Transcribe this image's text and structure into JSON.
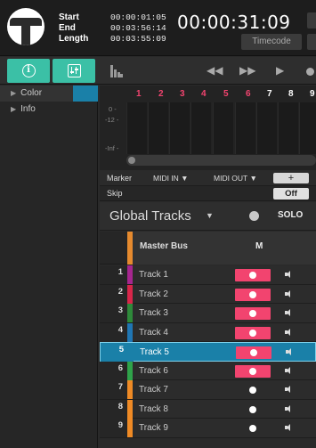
{
  "header": {
    "labels": [
      "Start",
      "End",
      "Length"
    ],
    "values": [
      "00:00:01:05",
      "00:03:56:14",
      "00:03:55:09"
    ],
    "current_time": "00:00:31:09",
    "time_mode": "Timecode"
  },
  "icons": {
    "logo": "t-logo",
    "info": "info-icon",
    "mixer": "mixer-icon",
    "meter": "meter-icon",
    "rewind": "rewind-icon",
    "fast_forward": "fast-forward-icon",
    "play": "play-icon",
    "record": "record-icon"
  },
  "inspector": {
    "items": [
      {
        "label": "Color"
      },
      {
        "label": "Info"
      }
    ],
    "color_value": "#1a80a8"
  },
  "meters": {
    "channels": [
      "1",
      "2",
      "3",
      "4",
      "5",
      "6",
      "7",
      "8",
      "9"
    ],
    "scale": [
      "0 -",
      "-12 -",
      "-Inf -"
    ]
  },
  "marker_row": {
    "label": "Marker",
    "midi_in": "MIDI IN ▼",
    "midi_out": "MIDI OUT ▼",
    "add": "+"
  },
  "skip_row": {
    "label": "Skip",
    "state": "Off"
  },
  "global_tracks": {
    "title": "Global Tracks",
    "caret": "▼",
    "solo_label": "SOLO"
  },
  "master_bus": {
    "name": "Master Bus",
    "mute_label": "M",
    "color": "#e68a2e"
  },
  "tracks": [
    {
      "num": "1",
      "name": "Track 1",
      "color": "#a6268f",
      "armed": true
    },
    {
      "num": "2",
      "name": "Track 2",
      "color": "#d8264a",
      "armed": true
    },
    {
      "num": "3",
      "name": "Track 3",
      "color": "#2e8a3a",
      "armed": true
    },
    {
      "num": "4",
      "name": "Track 4",
      "color": "#1f76b4",
      "armed": true
    },
    {
      "num": "5",
      "name": "Track 5",
      "color": "#1a80a8",
      "armed": true,
      "selected": true
    },
    {
      "num": "6",
      "name": "Track 6",
      "color": "#2fa34a",
      "armed": true
    },
    {
      "num": "7",
      "name": "Track 7",
      "color": "#ef8a25",
      "armed": false
    },
    {
      "num": "8",
      "name": "Track 8",
      "color": "#ef8a25",
      "armed": false
    },
    {
      "num": "9",
      "name": "Track 9",
      "color": "#ef8a25",
      "armed": false
    }
  ],
  "colors": {
    "accent": "#3bc0a6",
    "record_armed": "#f2446f",
    "selection": "#1a80a8",
    "meter_number": "#f2446f"
  }
}
